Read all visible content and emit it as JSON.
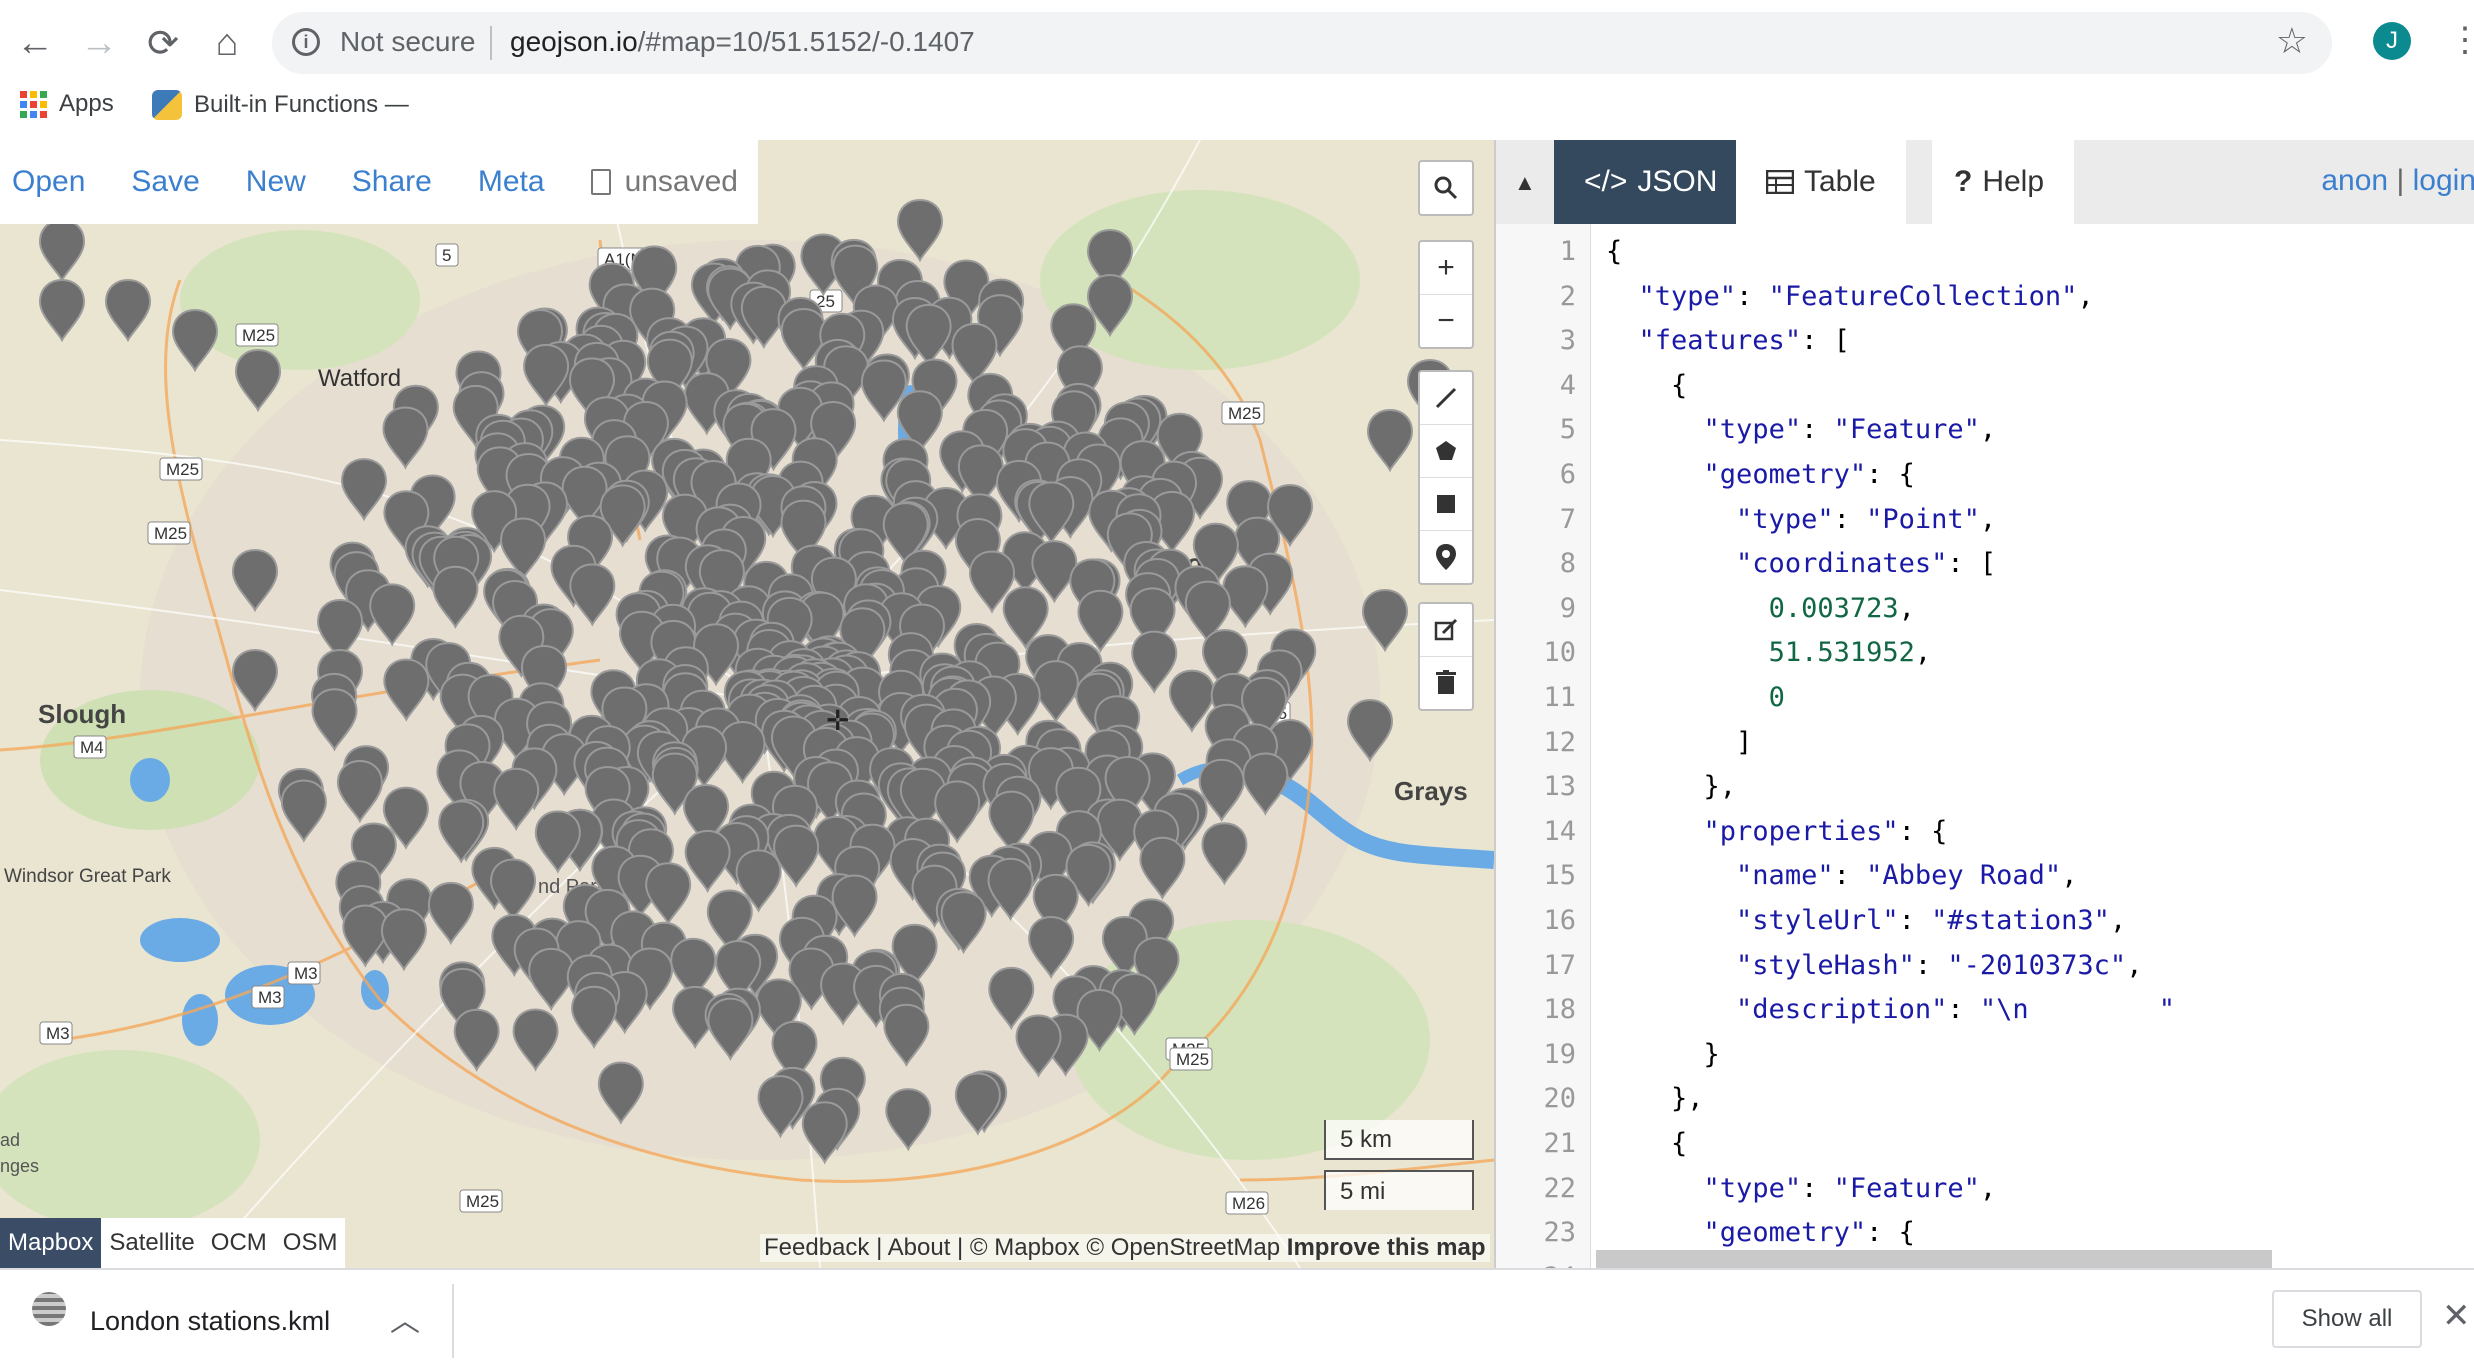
{
  "browser": {
    "security_label": "Not secure",
    "url_host": "geojson.io",
    "url_path": "/#map=10/51.5152/-0.1407",
    "profile_initial": "J",
    "bookmarks": [
      {
        "label": "Apps"
      },
      {
        "label": "Built-in Functions —"
      }
    ]
  },
  "map": {
    "menu": [
      "Open",
      "Save",
      "New",
      "Share",
      "Meta"
    ],
    "file_status": "unsaved",
    "zoom_in": "+",
    "zoom_out": "−",
    "layers": [
      "Mapbox",
      "Satellite",
      "OCM",
      "OSM"
    ],
    "active_layer": "Mapbox",
    "attribution": {
      "links": "Feedback | About | © Mapbox © OpenStreetMap",
      "improve": "Improve this map"
    },
    "scale": {
      "km": "5 km",
      "mi": "5 mi"
    },
    "place_labels": [
      {
        "text": "Watford"
      },
      {
        "text": "Slough"
      },
      {
        "text": "Windsor Great Park"
      },
      {
        "text": "Grays"
      },
      {
        "text": "Rom"
      },
      {
        "text": "nd Park"
      },
      {
        "text": "ad"
      },
      {
        "text": "nges"
      }
    ],
    "road_labels": [
      "M25",
      "M25",
      "M25",
      "M25",
      "M25",
      "M25",
      "M25",
      "M25",
      "M4",
      "M3",
      "M3",
      "M3",
      "M26",
      "A1(M)",
      "5",
      "25"
    ]
  },
  "panel": {
    "tabs": [
      {
        "label": "JSON",
        "icon": "code-icon"
      },
      {
        "label": "Table",
        "icon": "table-icon"
      },
      {
        "label": "Help",
        "icon": "question-icon"
      }
    ],
    "active_tab": "JSON",
    "account": {
      "anon": "anon",
      "sep": "|",
      "login": "login"
    },
    "code_lines": [
      {
        "n": "1",
        "t": "{"
      },
      {
        "n": "2",
        "t": "  \"type\": \"FeatureCollection\","
      },
      {
        "n": "3",
        "t": "  \"features\": ["
      },
      {
        "n": "4",
        "t": "    {"
      },
      {
        "n": "5",
        "t": "      \"type\": \"Feature\","
      },
      {
        "n": "6",
        "t": "      \"geometry\": {"
      },
      {
        "n": "7",
        "t": "        \"type\": \"Point\","
      },
      {
        "n": "8",
        "t": "        \"coordinates\": ["
      },
      {
        "n": "9",
        "t": "          0.003723,"
      },
      {
        "n": "10",
        "t": "          51.531952,"
      },
      {
        "n": "11",
        "t": "          0"
      },
      {
        "n": "12",
        "t": "        ]"
      },
      {
        "n": "13",
        "t": "      },"
      },
      {
        "n": "14",
        "t": "      \"properties\": {"
      },
      {
        "n": "15",
        "t": "        \"name\": \"Abbey Road\","
      },
      {
        "n": "16",
        "t": "        \"styleUrl\": \"#station3\","
      },
      {
        "n": "17",
        "t": "        \"styleHash\": \"-2010373c\","
      },
      {
        "n": "18",
        "t": "        \"description\": \"\\n        \""
      },
      {
        "n": "19",
        "t": "      }"
      },
      {
        "n": "20",
        "t": "    },"
      },
      {
        "n": "21",
        "t": "    {"
      },
      {
        "n": "22",
        "t": "      \"type\": \"Feature\","
      },
      {
        "n": "23",
        "t": "      \"geometry\": {"
      },
      {
        "n": "24",
        "t": "        \"type\": \"Point\","
      }
    ]
  },
  "downloads": {
    "file": "London stations.kml",
    "show_all": "Show all"
  },
  "colors": {
    "accent_blue": "#3b7fcf",
    "tab_active_bg": "#34495e",
    "marker_gray": "#6e6e6e",
    "json_key": "#1a1aa6",
    "json_number": "#116644",
    "water": "#6aabe6"
  }
}
